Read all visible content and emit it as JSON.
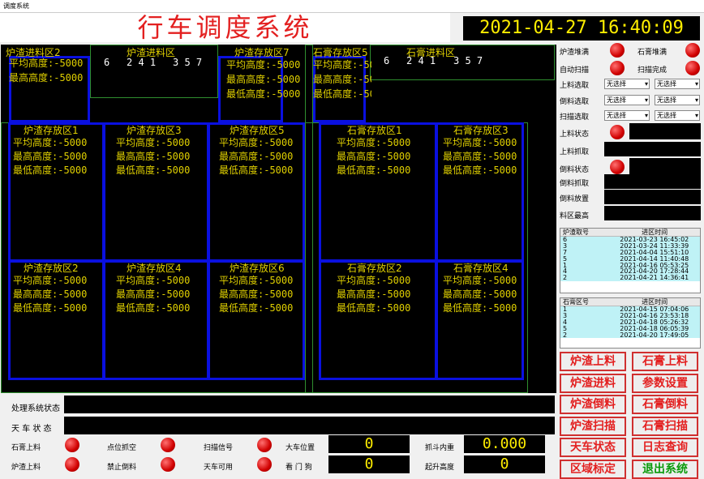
{
  "window": {
    "title": "调度系统"
  },
  "header": {
    "title": "行车调度系统",
    "clock": "2021-04-27  16:40:09"
  },
  "top_zones": [
    {
      "name": "炉渣进料区2",
      "stats": [
        "平均高度:-5000",
        "最高高度:-5000"
      ]
    },
    {
      "name": "炉渣进料区",
      "slots": [
        "6",
        "2 4 1",
        "3 5 7"
      ]
    },
    {
      "name": "炉渣存放区7",
      "stats": [
        "平均高度:-5000",
        "最高高度:-5000",
        "最低高度:-5000"
      ]
    },
    {
      "name": "石膏存放区5",
      "stats": [
        "平均高度:-50",
        "最高高度:-50",
        "最低高度:-50"
      ]
    },
    {
      "name": "石膏进料区",
      "slots": [
        "6",
        "2 4 1",
        "3 5 7"
      ]
    }
  ],
  "zones": [
    {
      "name": "炉渣存放区1",
      "stats": [
        "平均高度:-5000",
        "最高高度:-5000",
        "最低高度:-5000"
      ]
    },
    {
      "name": "炉渣存放区3",
      "stats": [
        "平均高度:-5000",
        "最高高度:-5000",
        "最低高度:-5000"
      ]
    },
    {
      "name": "炉渣存放区5",
      "stats": [
        "平均高度:-5000",
        "最高高度:-5000",
        "最低高度:-5000"
      ]
    },
    {
      "name": "石膏存放区1",
      "stats": [
        "平均高度:-5000",
        "最高高度:-5000",
        "最低高度:-5000"
      ]
    },
    {
      "name": "石膏存放区3",
      "stats": [
        "平均高度:-5000",
        "最高高度:-5000",
        "最低高度:-5000"
      ]
    },
    {
      "name": "炉渣存放区2",
      "stats": [
        "平均高度:-5000",
        "最高高度:-5000",
        "最低高度:-5000"
      ]
    },
    {
      "name": "炉渣存放区4",
      "stats": [
        "平均高度:-5000",
        "最高高度:-5000",
        "最低高度:-5000"
      ]
    },
    {
      "name": "炉渣存放区6",
      "stats": [
        "平均高度:-5000",
        "最高高度:-5000",
        "最低高度:-5000"
      ]
    },
    {
      "name": "石膏存放区2",
      "stats": [
        "平均高度:-5000",
        "最高高度:-5000",
        "最低高度:-5000"
      ]
    },
    {
      "name": "石膏存放区4",
      "stats": [
        "平均高度:-5000",
        "最高高度:-5000",
        "最低高度:-5000"
      ]
    }
  ],
  "right": {
    "lz_dui": "炉渣堆满",
    "sg_dui": "石膏堆满",
    "auto_scan": "自动扫描",
    "scan_done": "扫描完成",
    "feed_sel": "上料选取",
    "dump_sel": "倒料选取",
    "scan_sel": "扫描选取",
    "sel_value": "无选择",
    "feed_state": "上料状态",
    "feed_grab": "上料抓取",
    "dump_state": "倒料状态",
    "dump_grab": "倒料抓取",
    "dump_put": "倒料放置",
    "zone_max": "料区最高"
  },
  "lz_grid": {
    "headers": [
      "炉渣取号",
      "进区时间"
    ],
    "rows": [
      [
        "6",
        "2021-03-23 16:45:02"
      ],
      [
        "3",
        "2021-03-24 11:33:39"
      ],
      [
        "7",
        "2021-04-04 15:51:10"
      ],
      [
        "5",
        "2021-04-14 11:40:48"
      ],
      [
        "1",
        "2021-04-16 05:53:25"
      ],
      [
        "4",
        "2021-04-20 17:28:44"
      ],
      [
        "2",
        "2021-04-21 14:36:41"
      ]
    ]
  },
  "sg_grid": {
    "headers": [
      "石膏区号",
      "进区时间"
    ],
    "rows": [
      [
        "1",
        "2021-04-15 07:04:06"
      ],
      [
        "3",
        "2021-04-16 23:53:18"
      ],
      [
        "4",
        "2021-04-18 05:26:32"
      ],
      [
        "5",
        "2021-04-18 06:05:39"
      ],
      [
        "2",
        "2021-04-20 17:49:05"
      ]
    ]
  },
  "buttons": [
    "炉渣上料",
    "石膏上料",
    "炉渣进料",
    "参数设置",
    "炉渣倒料",
    "石膏倒料",
    "炉渣扫描",
    "石膏扫描",
    "天车状态",
    "日志查询",
    "区域标定",
    "退出系统"
  ],
  "bottom": {
    "process_state": "处理系统状态",
    "crane_state": "天  车  状  态",
    "sg_feed": "石膏上料",
    "lz_feed": "炉渣上料",
    "point_grab": "点位抓空",
    "no_dump": "禁止倒料",
    "scan_signal": "扫描信号",
    "crane_avail": "天车可用",
    "cart_pos": "大车位置",
    "watchdog": "看  门  狗",
    "cart_val": "0",
    "watchdog_val": "0",
    "bucket": "抓斗内重",
    "bucket_val": "0.000",
    "lift": "起升高度",
    "lift_val": "0"
  }
}
